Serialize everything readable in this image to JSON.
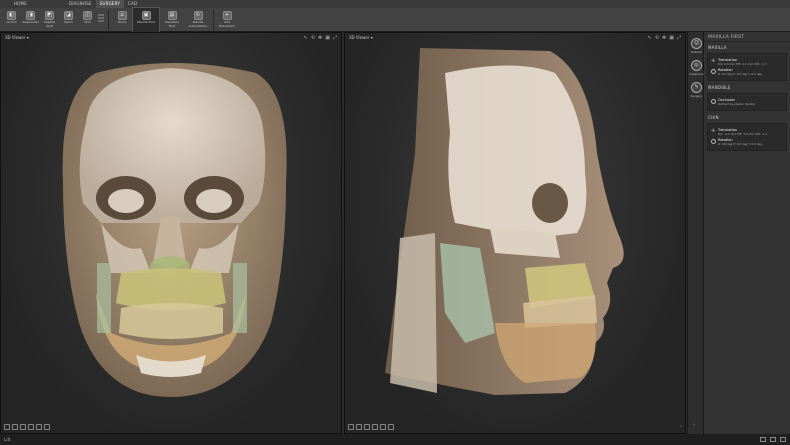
{
  "top_tabs": [
    {
      "label": "HOME",
      "active": false
    },
    {
      "label": "DIAGNOSE",
      "active": false
    },
    {
      "label": "SURGERY",
      "active": true
    },
    {
      "label": "CAD",
      "active": false
    }
  ],
  "ribbon": {
    "groups": [
      [
        {
          "label": "Le Fort",
          "icon": "lefort-icon",
          "glyph": "◧"
        },
        {
          "label": "Segmental",
          "icon": "segment-icon",
          "glyph": "◨"
        },
        {
          "label": "Sagittal\nSplit",
          "icon": "sagittal-split-icon",
          "glyph": "◩"
        },
        {
          "label": "Genio",
          "icon": "genio-icon",
          "glyph": "◪"
        },
        {
          "label": "Chin",
          "icon": "chin-icon",
          "glyph": "◫"
        }
      ],
      [
        {
          "label": "Home",
          "icon": "home-icon",
          "glyph": "⌂"
        },
        {
          "label": "Maxilla First",
          "icon": "maxilla-first-icon",
          "glyph": "▣",
          "active": true
        },
        {
          "label": "Mandible\nFirst",
          "icon": "mandible-first-icon",
          "glyph": "▤"
        },
        {
          "label": "Maxilla\nAutorotation",
          "icon": "autorotation-icon",
          "glyph": "↻"
        },
        {
          "label": "Add\nDistraction",
          "icon": "distraction-icon",
          "glyph": "+"
        }
      ]
    ]
  },
  "viewports": {
    "left": {
      "title": "3D Viewer ▾"
    },
    "right": {
      "title": "3D Viewer ▾"
    }
  },
  "rail": [
    {
      "label": "Patient",
      "icon": "patient-icon",
      "glyph": "☺"
    },
    {
      "label": "Diagnose",
      "icon": "diagnose-icon",
      "glyph": "◎"
    },
    {
      "label": "Surgery",
      "icon": "surgery-icon",
      "glyph": "✎"
    }
  ],
  "panel": {
    "title": "MAXILLA FIRST",
    "sections": [
      {
        "heading": "MAXILLA",
        "rows": [
          {
            "name": "Translation",
            "values": "R/L: 0.0 mm   F/B: 1.2 mm   U/D: -1.7",
            "icon": "translation-icon",
            "kind": "cross"
          },
          {
            "name": "Rotation",
            "values": "R: 0.0 deg   P: 6.0 deg   Y: 0.0 deg",
            "icon": "rotation-icon",
            "kind": "circle"
          }
        ]
      },
      {
        "heading": "MANDIBLE",
        "rows": [
          {
            "name": "Occlusion",
            "values": "Defined by plaster models",
            "icon": "occlusion-icon",
            "kind": "circle"
          }
        ]
      },
      {
        "heading": "CHIN",
        "rows": [
          {
            "name": "Translation",
            "values": "R/L: -2.1 mm   F/B: 3.9 mm   U/D: -1.1",
            "icon": "translation-icon",
            "kind": "cross"
          },
          {
            "name": "Rotation",
            "values": "R: 0.0 deg   P: 0.0 deg   Y: 0.0 deg",
            "icon": "rotation-icon",
            "kind": "circle"
          }
        ]
      }
    ]
  },
  "status": {
    "text": "Ldt"
  }
}
